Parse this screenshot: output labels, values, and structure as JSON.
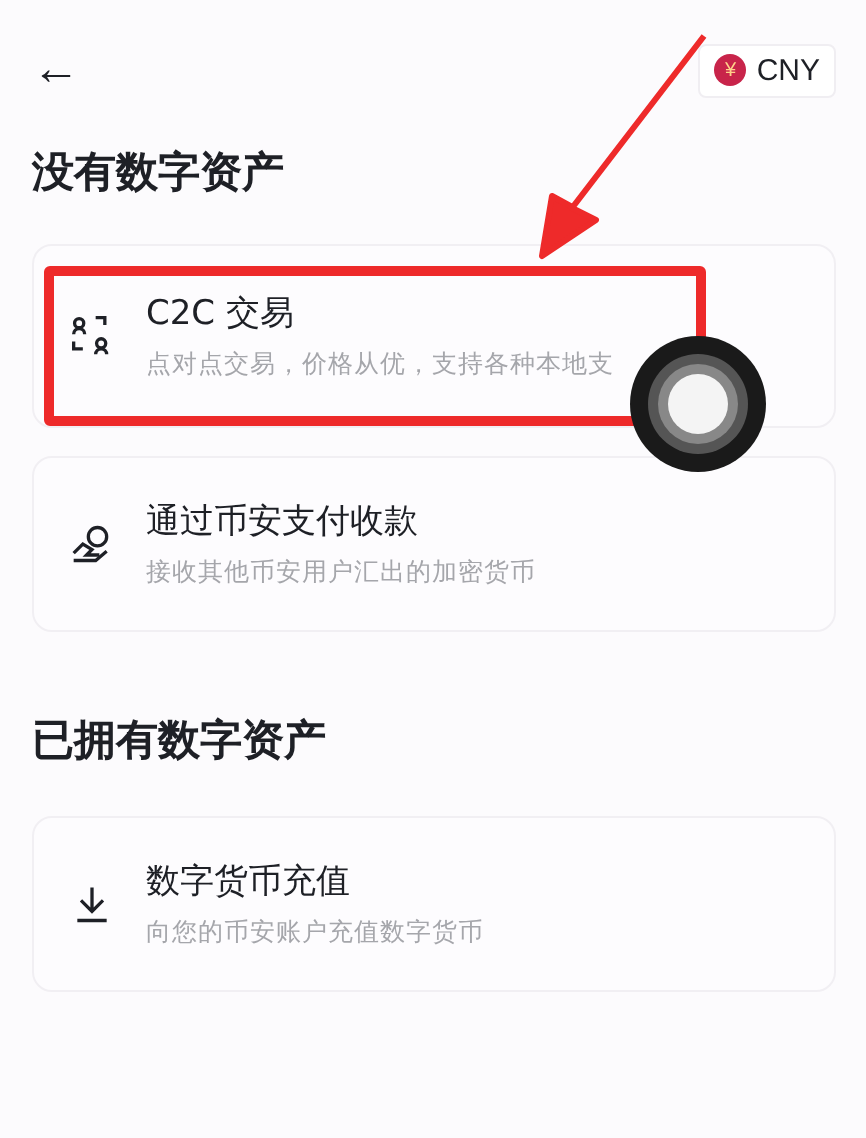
{
  "header": {
    "back": "←",
    "currency": {
      "symbol": "¥",
      "code": "CNY"
    }
  },
  "sections": [
    {
      "title": "没有数字资产",
      "items": [
        {
          "kind": "people",
          "title": "C2C 交易",
          "subtitle": "点对点交易，价格从优，支持各种本地支"
        },
        {
          "kind": "hand",
          "title": "通过币安支付收款",
          "subtitle": "接收其他币安用户汇出的加密货币"
        }
      ]
    },
    {
      "title": "已拥有数字资产",
      "items": [
        {
          "kind": "download",
          "title": "数字货币充值",
          "subtitle": "向您的币安账户充值数字货币"
        }
      ]
    }
  ],
  "overlays": [
    {
      "kind": "highlight-box"
    },
    {
      "kind": "arrow"
    },
    {
      "kind": "touch-point"
    }
  ]
}
